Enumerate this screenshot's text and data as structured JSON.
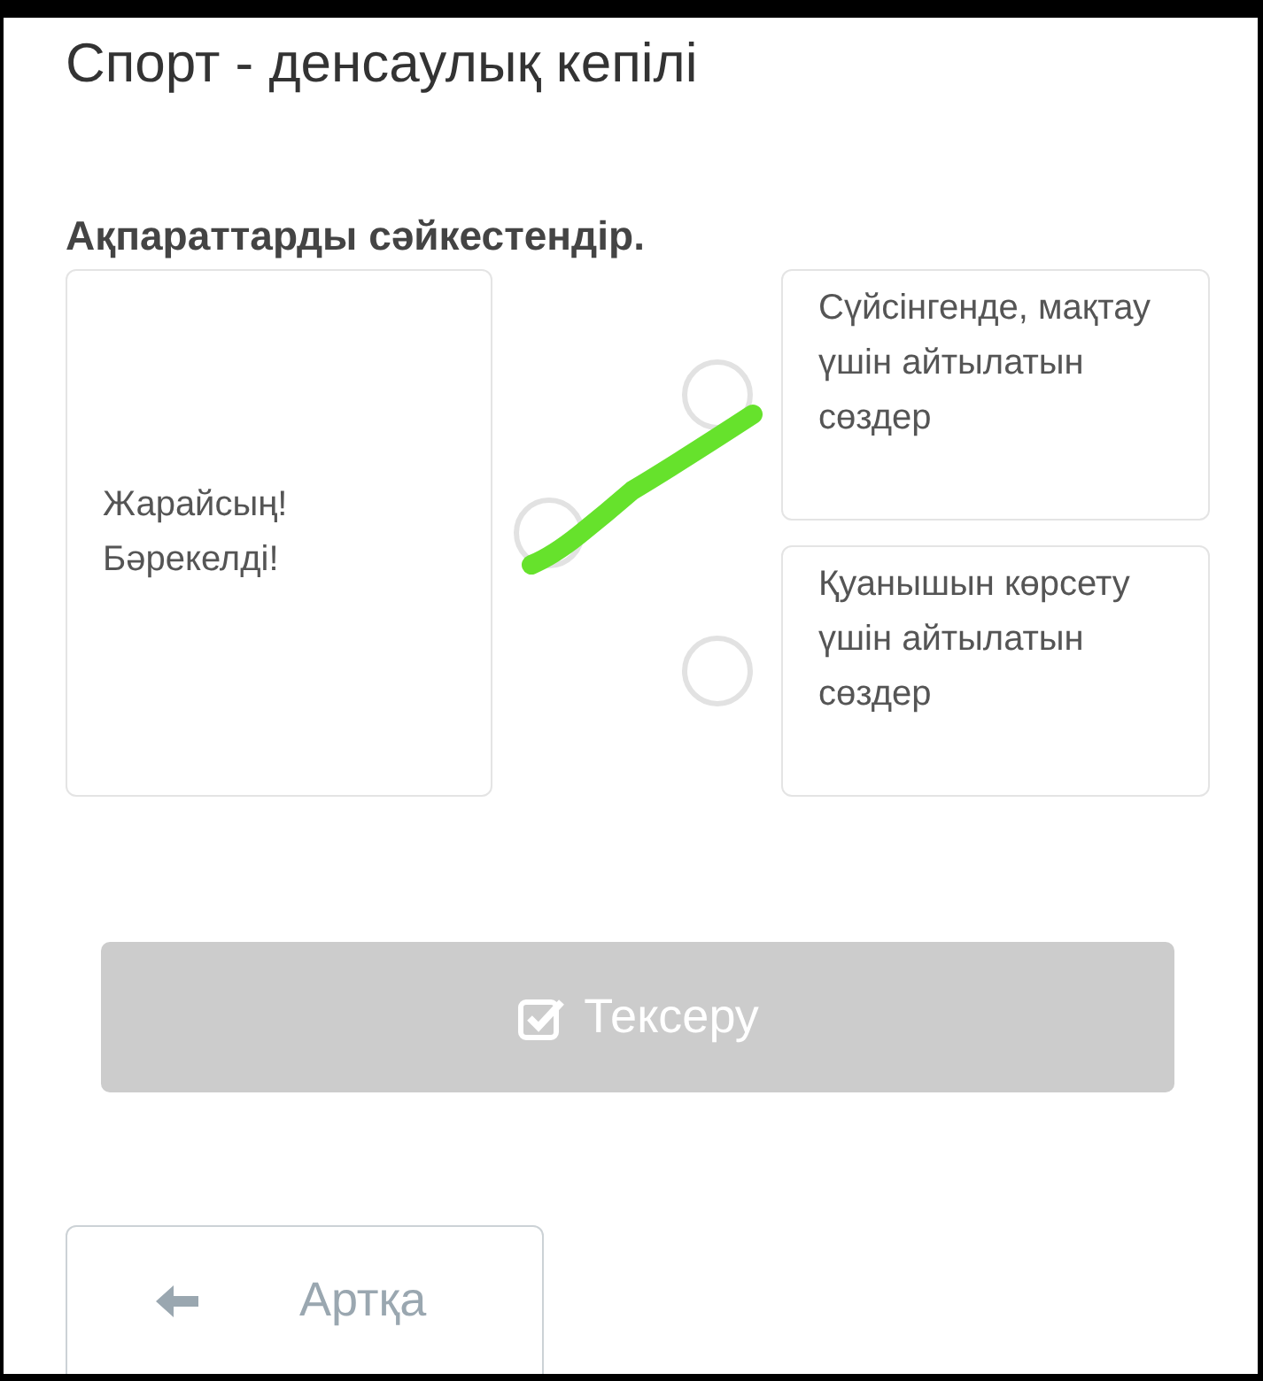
{
  "title": "Спорт - денсаулық кепілі",
  "instruction": "Ақпараттарды сәйкестендір.",
  "left_items": [
    {
      "text": "Жарайсың! Бәрекелді!"
    }
  ],
  "right_items": [
    {
      "text": "Сүйсінгенде, мақтау үшін айтылатын сөздер"
    },
    {
      "text": "Қуанышын көрсету үшін айтылатын сөздер"
    }
  ],
  "annotation": {
    "kind": "freehand-line",
    "color": "#66e22c"
  },
  "check_button": {
    "label": "Тексеру",
    "disabled": true
  },
  "back_button": {
    "label": "Артқа"
  }
}
